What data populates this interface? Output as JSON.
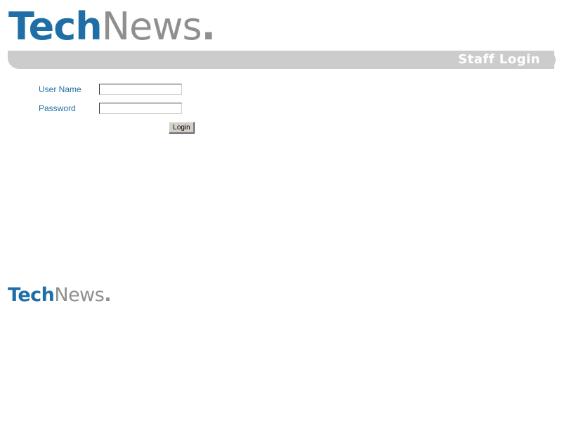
{
  "header": {
    "logo": {
      "part1": "Tech",
      "part2": "News",
      "part3": "."
    },
    "title_bar": {
      "text": "Staff Login"
    }
  },
  "login_form": {
    "username": {
      "label": "User Name",
      "value": "",
      "placeholder": ""
    },
    "password": {
      "label": "Password",
      "value": "",
      "placeholder": ""
    },
    "submit_label": "Login"
  },
  "footer": {
    "logo": {
      "part1": "Tech",
      "part2": "News",
      "part3": "."
    }
  },
  "colors": {
    "brand_blue": "#1f6fa6",
    "brand_gray": "#8f8f8f",
    "title_bar_bg": "#cccccc",
    "title_bar_text": "#ffffff"
  }
}
